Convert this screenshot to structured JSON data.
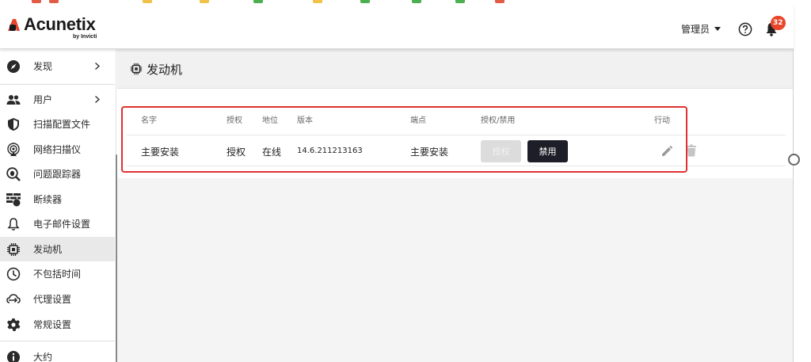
{
  "header": {
    "brand": "Acunetix",
    "brand_sub": "by Invicti",
    "user_label": "管理员",
    "notification_count": "32"
  },
  "sidebar": {
    "items": [
      {
        "label": "发现",
        "icon": "compass-icon",
        "has_chevron": true
      },
      {
        "label": "用户",
        "icon": "users-icon",
        "has_chevron": true
      },
      {
        "label": "扫描配置文件",
        "icon": "shield-icon"
      },
      {
        "label": "网络扫描仪",
        "icon": "network-scanner-icon"
      },
      {
        "label": "问题跟踪器",
        "icon": "bug-search-icon"
      },
      {
        "label": "断续器",
        "icon": "firewall-icon"
      },
      {
        "label": "电子邮件设置",
        "icon": "bell-outline-icon"
      },
      {
        "label": "发动机",
        "icon": "chip-icon",
        "active": true
      },
      {
        "label": "不包括时间",
        "icon": "clock-icon"
      },
      {
        "label": "代理设置",
        "icon": "proxy-icon"
      },
      {
        "label": "常规设置",
        "icon": "gear-icon"
      },
      {
        "label": "大约",
        "icon": "info-icon"
      }
    ]
  },
  "page": {
    "title": "发动机"
  },
  "table": {
    "columns": [
      "名字",
      "授权",
      "地位",
      "版本",
      "端点",
      "授权/禁用",
      "行动"
    ],
    "rows": [
      {
        "name": "主要安装",
        "authorization": "授权",
        "status": "在线",
        "version": "14.6.211213163",
        "endpoint": "主要安装",
        "grant_button": "授权",
        "disable_button": "禁用"
      }
    ]
  },
  "colors": {
    "accent_badge": "#e8462a",
    "highlight_box": "#e03131",
    "dark_button": "#1e1e28"
  }
}
